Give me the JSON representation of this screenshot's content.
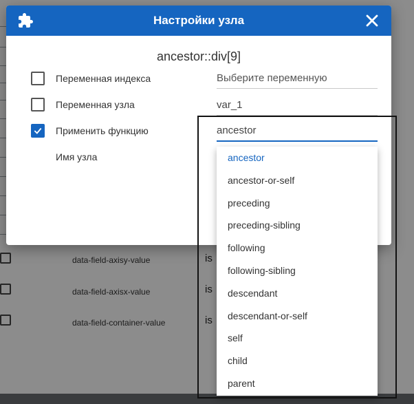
{
  "background": {
    "field_names": [
      "data-field-axisy-value",
      "data-field-axisx-value",
      "data-field-container-value"
    ],
    "operator_label": "is"
  },
  "dialog": {
    "title": "Настройки узла",
    "node_path": "ancestor::div[9]",
    "header_color": "#1565c0",
    "rows": [
      {
        "label": "Переменная индекса",
        "checked": false,
        "field_value": "Выберите переменную"
      },
      {
        "label": "Переменная узла",
        "checked": false,
        "field_value": "var_1"
      },
      {
        "label": "Применить функцию",
        "checked": true,
        "field_value": "ancestor"
      },
      {
        "label": "Имя узла"
      }
    ]
  },
  "dropdown": {
    "selected": "ancestor",
    "options": [
      "ancestor",
      "ancestor-or-self",
      "preceding",
      "preceding-sibling",
      "following",
      "following-sibling",
      "descendant",
      "descendant-or-self",
      "self",
      "child",
      "parent"
    ]
  }
}
